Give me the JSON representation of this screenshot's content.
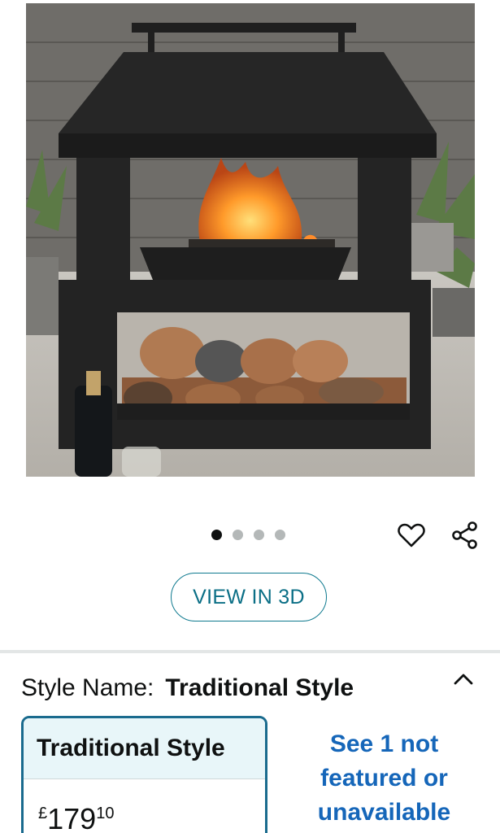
{
  "product": {
    "image_alt": "Black fireplace-style fire pit with burning logs and log storage underneath",
    "carousel": {
      "total": 4,
      "active": 1
    }
  },
  "actions": {
    "view_3d_label": "VIEW IN 3D"
  },
  "style": {
    "label": "Style Name:",
    "selected": "Traditional Style",
    "card_title": "Traditional Style",
    "price": {
      "currency": "£",
      "whole": "179",
      "fraction": "10"
    },
    "see_more_link": "See 1 not featured or unavailable"
  },
  "icons": {
    "favorite": "heart-icon",
    "share": "share-icon",
    "collapse": "chevron-up-icon"
  },
  "colors": {
    "accent_teal": "#0f7a8f",
    "link_blue": "#1566b9",
    "card_border": "#1a6b8e",
    "card_header_bg": "#e8f6f9"
  }
}
